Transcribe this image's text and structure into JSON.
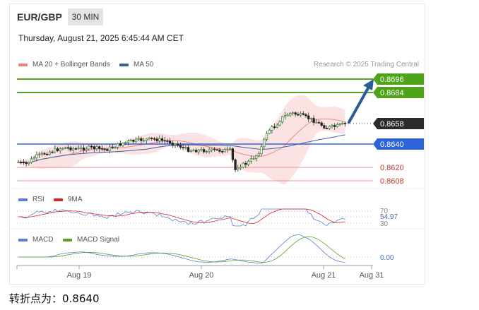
{
  "header": {
    "pair": "EUR/GBP",
    "timeframe": "30 MIN",
    "datetime": "Thursday, August 21, 2025 6:45:44 AM CET"
  },
  "legend": {
    "ma20": {
      "label": "MA 20 + Bollinger Bands",
      "color": "#f08080"
    },
    "ma50": {
      "label": "MA 50",
      "color": "#3a5f9a"
    },
    "research": "Research © 2025 Trading Central"
  },
  "levels": [
    {
      "id": "resistance-2",
      "value": "0.8696",
      "style": "green-badge"
    },
    {
      "id": "resistance-1",
      "value": "0.8684",
      "style": "green-badge"
    },
    {
      "id": "last-price",
      "value": "0.8658",
      "style": "dark-badge"
    },
    {
      "id": "pivot",
      "value": "0.8640",
      "style": "blue-badge"
    },
    {
      "id": "support-1",
      "value": "0.8620",
      "style": "red-text"
    },
    {
      "id": "support-2",
      "value": "0.8608",
      "style": "red-text"
    }
  ],
  "rsi": {
    "label": "RSI",
    "ma_label": "9MA",
    "level_high": "70",
    "level_low": "30",
    "value": "54.97",
    "color": "#5b7fd1",
    "ma_color": "#d62728"
  },
  "macd": {
    "label": "MACD",
    "signal_label": "MACD Signal",
    "value": "0.00",
    "color": "#5b7fd1",
    "signal_color": "#5aa02c"
  },
  "xaxis": {
    "ticks": [
      "Aug 19",
      "Aug 20",
      "Aug 21",
      "Aug 31"
    ]
  },
  "caption": "转折点为：0.8640"
}
